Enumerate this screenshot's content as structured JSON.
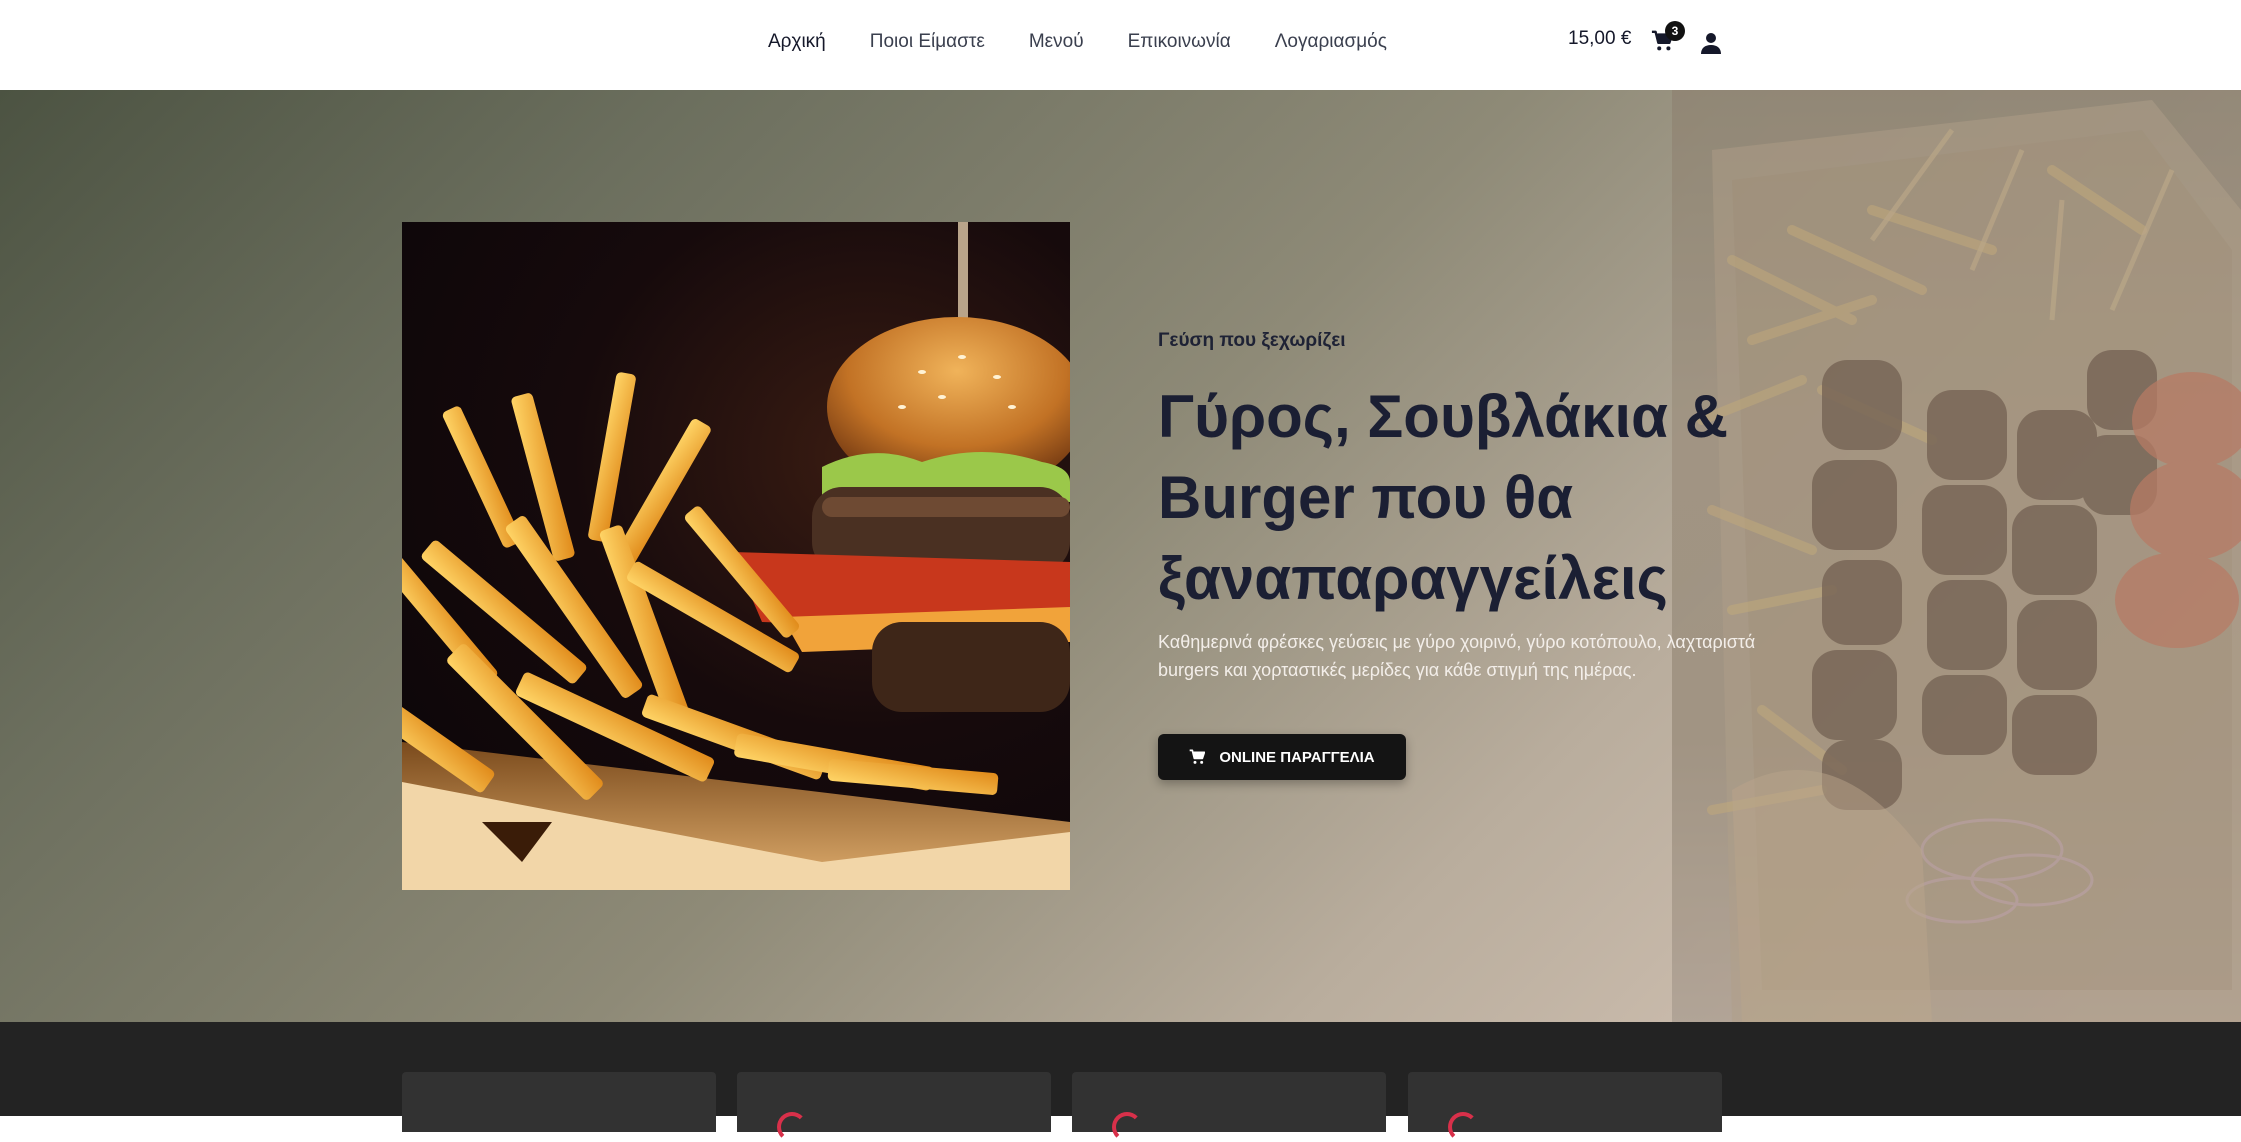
{
  "nav": {
    "items": [
      {
        "label": "Αρχική",
        "active": true
      },
      {
        "label": "Ποιοι Είμαστε",
        "active": false
      },
      {
        "label": "Μενού",
        "active": false
      },
      {
        "label": "Επικοινωνία",
        "active": false
      },
      {
        "label": "Λογαριασμός",
        "active": false
      }
    ]
  },
  "cart": {
    "total": "15,00 €",
    "count": "3",
    "icon": "cart-icon"
  },
  "account": {
    "icon": "user-icon"
  },
  "hero": {
    "eyebrow": "Γεύση που ξεχωρίζει",
    "title": "Γύρος, Σουβλάκια & Burger που θα ξαναπαραγγείλεις",
    "description": "Καθημερινά φρέσκες γεύσεις με γύρο χοιρινό, γύρο κοτόπουλο, λαχταριστά burgers και χορταστικές μερίδες για κάθε στιγμή της ημέρας.",
    "cta_label": "ONLINE ΠΑΡΑΓΓΕΛΙΑ",
    "photo": "burger-and-fries-photo",
    "background_photo": "souvlaki-skewers-photo"
  },
  "colors": {
    "accent": "#d8304a",
    "button": "#141414",
    "footer_strip": "#232323",
    "card": "#323232"
  },
  "features": {
    "cards": 4
  }
}
